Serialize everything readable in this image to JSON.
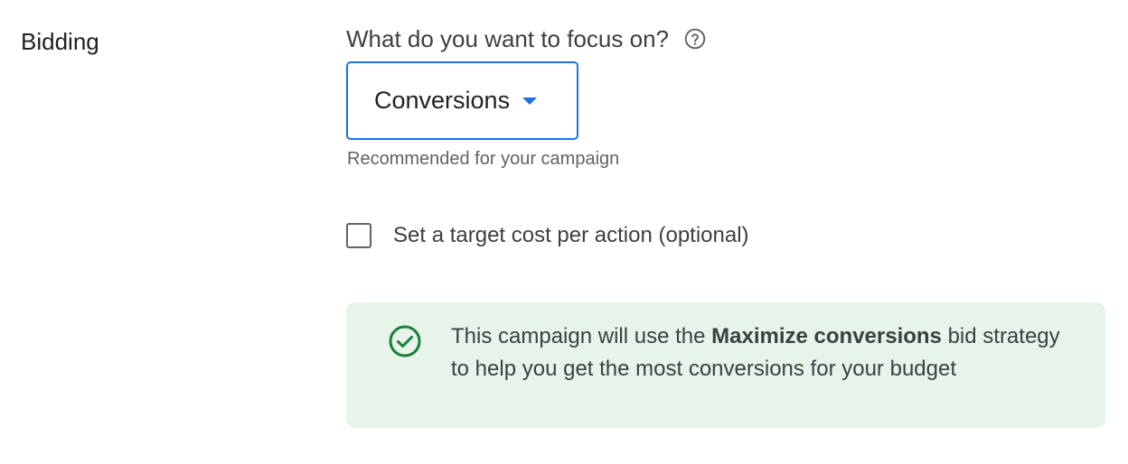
{
  "section": {
    "label": "Bidding"
  },
  "focus": {
    "question": "What do you want to focus on?",
    "help_icon": "help-circle-icon",
    "selected_value": "Conversions",
    "helper_text": "Recommended for your campaign"
  },
  "target_cpa": {
    "label": "Set a target cost per action (optional)",
    "checked": false
  },
  "info": {
    "icon": "check-circle-icon",
    "text_before": "This campaign will use the ",
    "strategy_name": "Maximize conversions",
    "text_after": " bid strategy to help you get the most conversions for your budget"
  },
  "colors": {
    "accent": "#1a73e8",
    "success_bg": "#e6f4ea",
    "success_icon": "#188038"
  }
}
